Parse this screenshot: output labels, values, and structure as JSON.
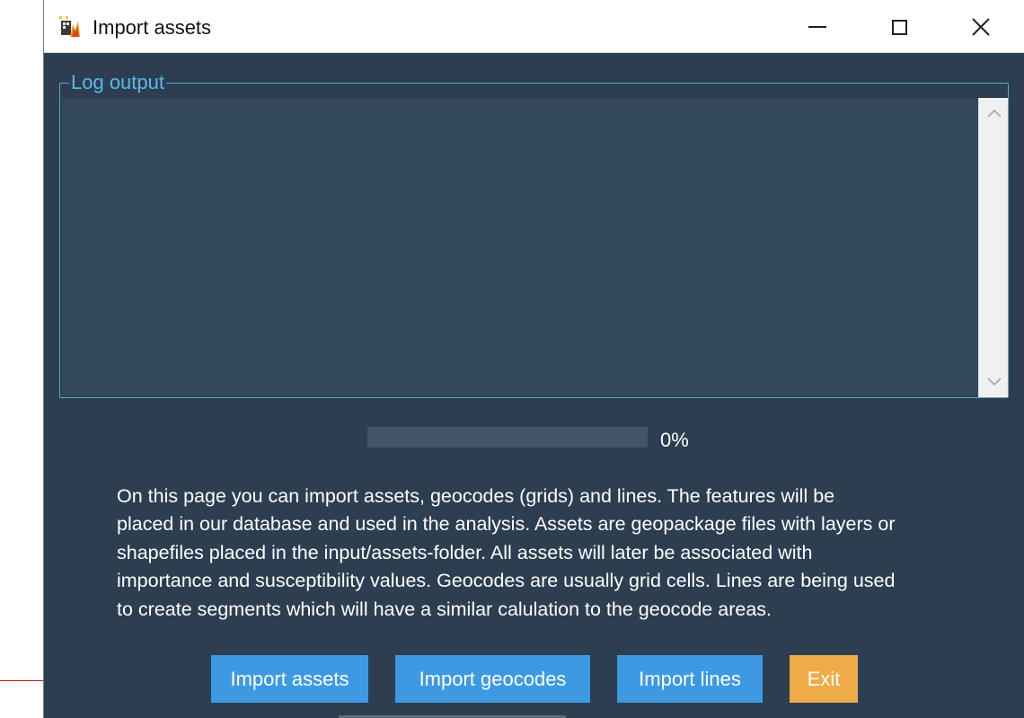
{
  "window": {
    "title": "Import assets",
    "bg_color": "#2c3e50",
    "controls": {
      "minimize_icon": "minimize-icon",
      "maximize_icon": "maximize-icon",
      "close_icon": "close-icon",
      "close_glyph": "✕"
    }
  },
  "log": {
    "legend": "Log output",
    "content": "",
    "border_color": "#5ea8cc",
    "scroll_up_glyph": "︿",
    "scroll_down_glyph": "﹀"
  },
  "progress": {
    "value_percent": 0,
    "label": "0%"
  },
  "description": "On this page you can import assets, geocodes (grids) and lines. The features will be\nplaced in our database and used in the analysis. Assets are geopackage files with layers or\nshapefiles placed in the input/assets-folder. All assets will later be associated with\nimportance and susceptibility values. Geocodes are usually grid cells. Lines are being used\nto create segments which will have a similar calulation to the geocode areas.",
  "buttons": {
    "import_assets": "Import assets",
    "import_geocodes": "Import geocodes",
    "import_lines": "Import lines",
    "exit": "Exit"
  },
  "colors": {
    "primary_button": "#3d9ae2",
    "exit_button": "#eeab47",
    "annotation_arrow": "#b01a1a"
  }
}
